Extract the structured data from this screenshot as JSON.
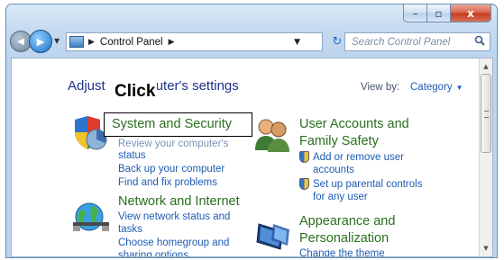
{
  "window": {
    "buttons": {
      "minimize": "–",
      "maximize": "▫",
      "close": "x"
    }
  },
  "navbar": {
    "back": "◀",
    "forward": "▶",
    "breadcrumb_separator": "▶",
    "address": "Control Panel",
    "address_trailing_separator": "▶",
    "dropdown": "▼",
    "refresh": "↻",
    "search_placeholder": "Search Control Panel",
    "search_icon": "magnifier-icon"
  },
  "content": {
    "heading_left": "Adjust",
    "heading_right": "uter's settings",
    "view_by_label": "View by:",
    "view_by_value": "Category",
    "annotation": "Click",
    "categories": [
      {
        "title": "System and Security",
        "icon": "shield-pie-icon",
        "links": [
          "Review your computer's",
          "status",
          "Back up your computer",
          "Find and fix problems"
        ]
      },
      {
        "title": "Network and Internet",
        "icon": "globe-network-icon",
        "links": [
          "View network status and",
          "tasks",
          "Choose homegroup and",
          "sharing options"
        ]
      },
      {
        "title_lines": [
          "User Accounts and",
          "Family Safety"
        ],
        "icon": "users-icon",
        "links": [
          "Add or remove user",
          "accounts",
          "Set up parental controls",
          "for any user"
        ]
      },
      {
        "title_lines": [
          "Appearance and",
          "Personalization"
        ],
        "icon": "appearance-icon",
        "links": [
          "Change the theme"
        ]
      }
    ]
  }
}
